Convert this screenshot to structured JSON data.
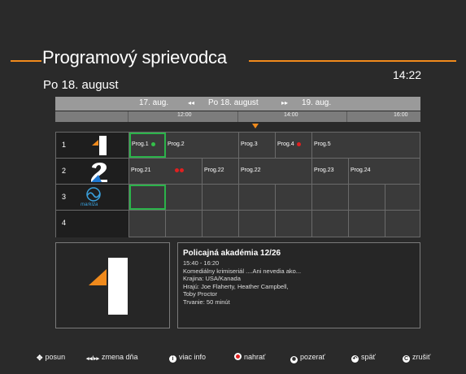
{
  "header": {
    "title": "Programový sprievodca",
    "date": "Po 18. august",
    "clock": "14:22"
  },
  "date_nav": {
    "prev_day": "17. aug.",
    "prev_icon": "◂◂",
    "current_day": "Po 18. august",
    "next_icon": "▸▸",
    "next_day": "19. aug."
  },
  "timeline": {
    "times": [
      "12:00",
      "14:00",
      "16:00"
    ]
  },
  "channels": [
    {
      "number": "1",
      "logo": "jednotka-logo",
      "programs": [
        {
          "label": "Prog.1",
          "dot": "green",
          "selected": true
        },
        {
          "label": "Prog.2"
        },
        {
          "label": "Prog.3"
        },
        {
          "label": "Prog.4",
          "dot": "red"
        },
        {
          "label": "Prog.5"
        }
      ]
    },
    {
      "number": "2",
      "logo": "dvojka-logo",
      "programs": [
        {
          "label": "Prog.21",
          "dots": [
            "red",
            "red"
          ]
        },
        {
          "label": "Prog.22"
        },
        {
          "label": "Prog.22"
        },
        {
          "label": "Prog.23"
        },
        {
          "label": "Prog.24"
        }
      ]
    },
    {
      "number": "3",
      "logo": "markiza-logo",
      "logo_text": "markíza",
      "programs": []
    },
    {
      "number": "4",
      "logo": "",
      "programs": []
    }
  ],
  "details": {
    "title": "Policajná akadémia 12/26",
    "time": "15:40 - 16:20",
    "description": "Komediálny krimiseriál ....Ani nevedia ako...",
    "country": "Krajina: USA/Kanada",
    "cast_1": "Hrajú: Joe Flaherty, Heather Campbell,",
    "cast_2": "Toby Proctor",
    "duration": "Trvanie: 50 minút"
  },
  "footer": {
    "move": "posun",
    "change_day": "zmena dňa",
    "more_info": "viac info",
    "record": "nahrať",
    "watch": "pozerať",
    "back": "späť",
    "cancel": "zrušiť"
  },
  "colors": {
    "accent": "#f08a1c",
    "selection": "#2bb34a",
    "record_red": "#e02020"
  }
}
